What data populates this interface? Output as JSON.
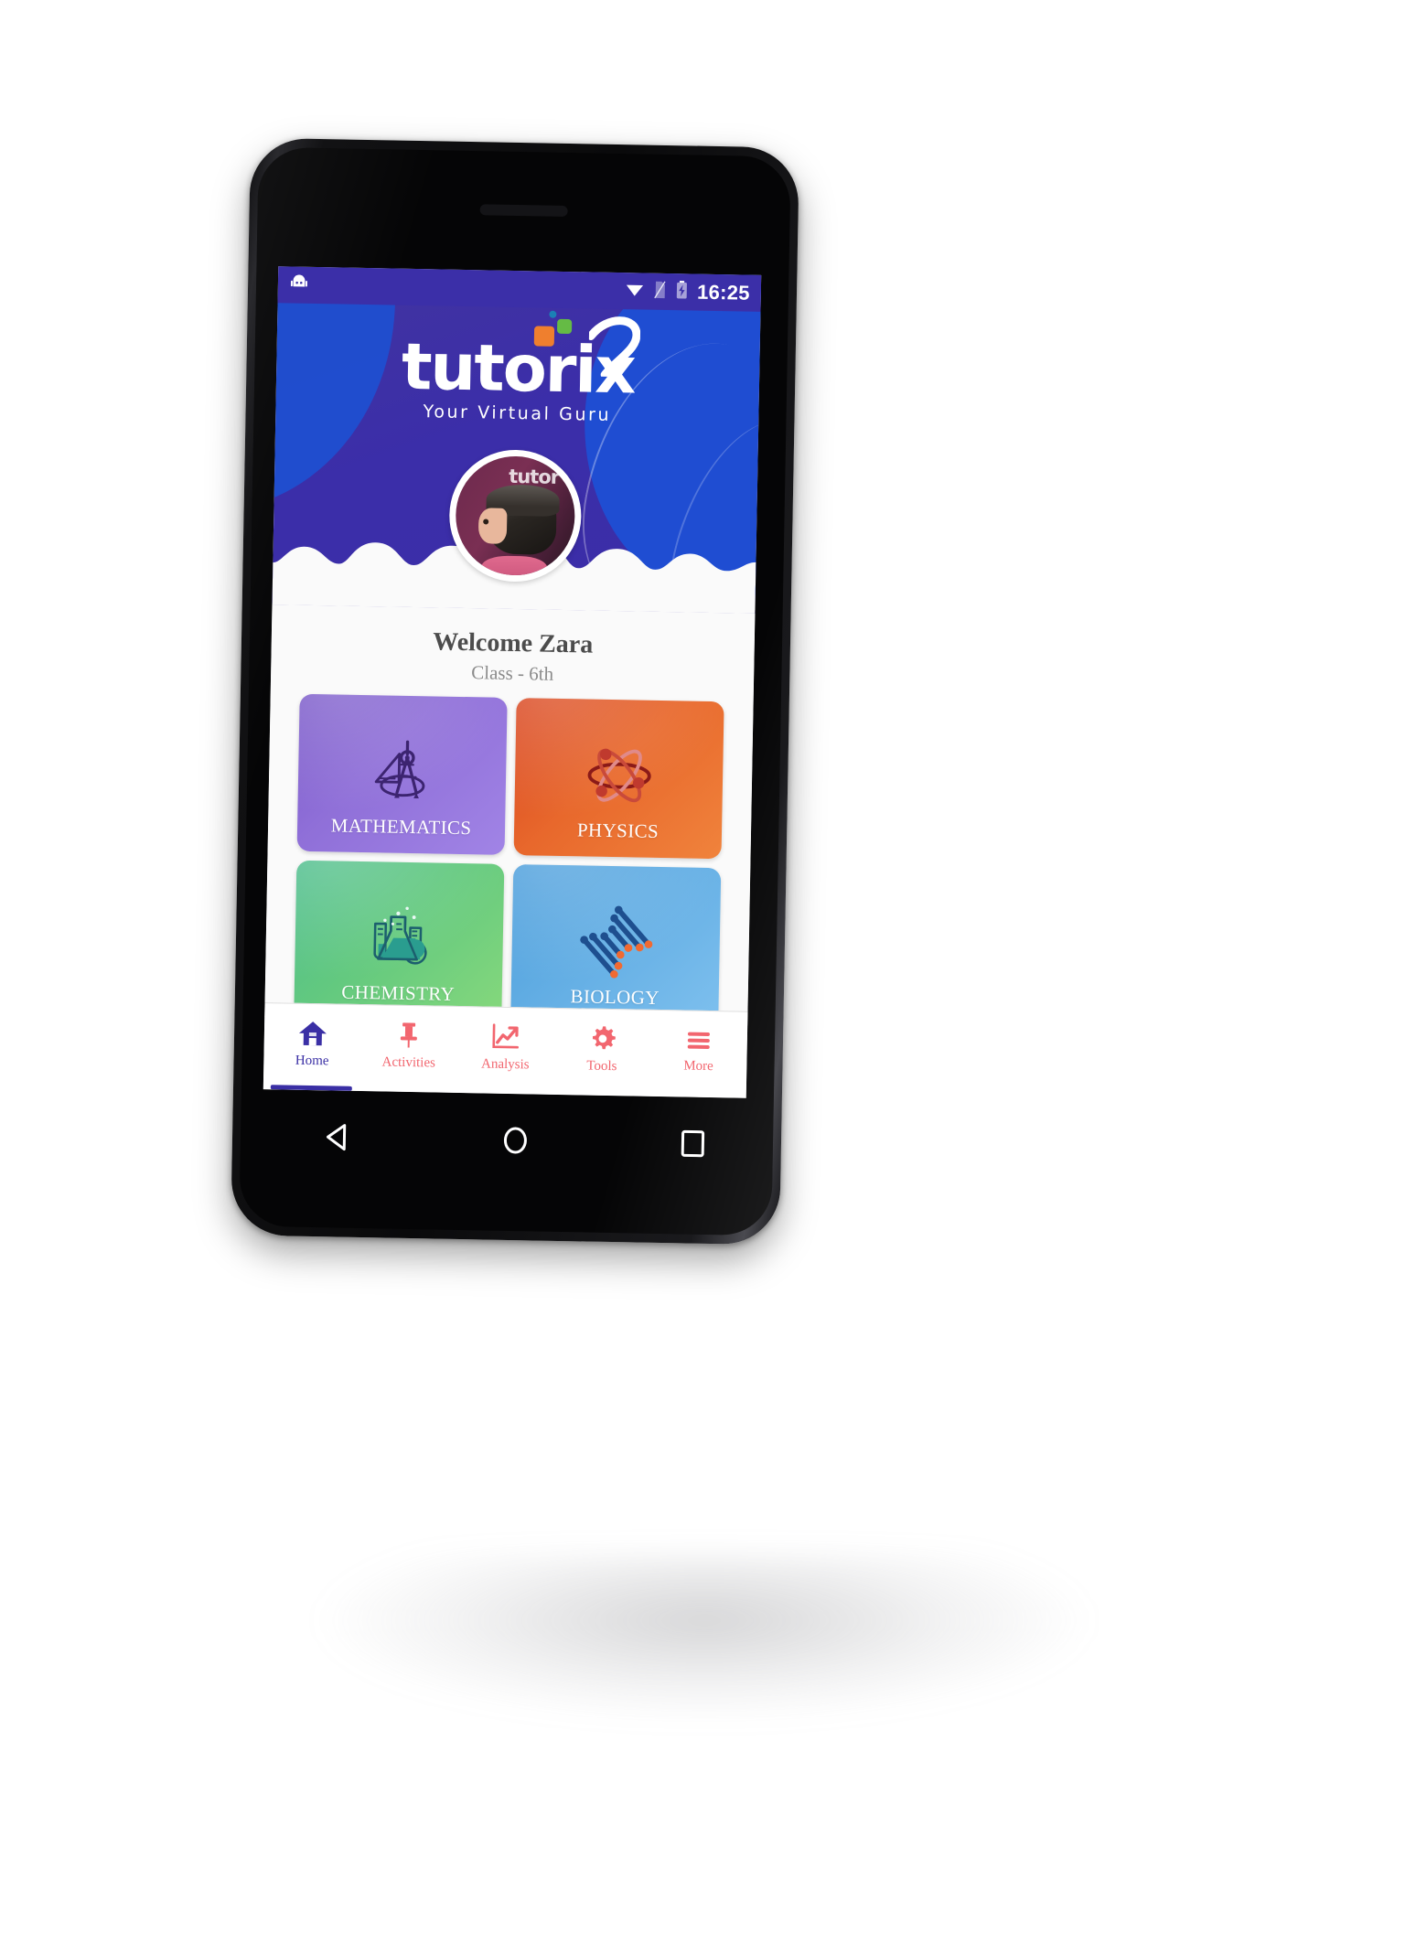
{
  "status_bar": {
    "clock": "16:25",
    "icons": [
      "android-notification-icon",
      "wifi-icon",
      "no-sim-icon",
      "battery-charging-icon"
    ]
  },
  "brand": {
    "name": "tutorix",
    "name_main": "tutori",
    "name_x": "x",
    "tagline": "Your Virtual Guru",
    "colors": {
      "header_purple": "#3b2da8",
      "header_blue_blob": "#1d4fd4",
      "square_orange": "#ef7f2e",
      "square_green": "#65bb45",
      "square_teal": "#1b7fb5"
    }
  },
  "profile": {
    "avatar_name": "student-avatar",
    "welcome": "Welcome Zara",
    "class": "Class - 6th"
  },
  "subjects": [
    {
      "label": "MATHEMATICS",
      "icon": "compass-and-set-square-icon",
      "accent": "#8f6fd8"
    },
    {
      "label": "PHYSICS",
      "icon": "atom-icon",
      "accent": "#e8682c"
    },
    {
      "label": "CHEMISTRY",
      "icon": "flasks-icon",
      "accent": "#63c97f"
    },
    {
      "label": "BIOLOGY",
      "icon": "dna-helix-icon",
      "accent": "#63aee4"
    }
  ],
  "bottom_nav": {
    "active_index": 0,
    "active_color": "#3a2fa5",
    "inactive_color": "#f2666f",
    "items": [
      {
        "label": "Home",
        "icon": "home-icon"
      },
      {
        "label": "Activities",
        "icon": "pushpin-icon"
      },
      {
        "label": "Analysis",
        "icon": "line-chart-icon"
      },
      {
        "label": "Tools",
        "icon": "gear-icon"
      },
      {
        "label": "More",
        "icon": "hamburger-menu-icon"
      }
    ]
  },
  "android_nav": {
    "buttons": [
      {
        "label": "Back",
        "icon": "triangle-back-icon"
      },
      {
        "label": "Home",
        "icon": "circle-home-icon"
      },
      {
        "label": "Recents",
        "icon": "square-recents-icon"
      }
    ]
  }
}
